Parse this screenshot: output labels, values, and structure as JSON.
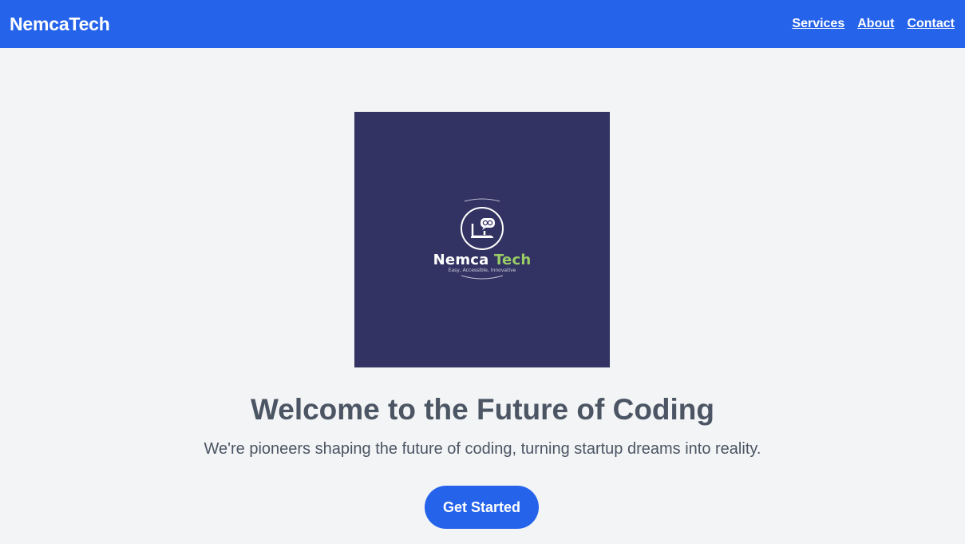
{
  "header": {
    "brand": "NemcaTech",
    "nav": [
      "Services",
      "About",
      "Contact"
    ]
  },
  "hero": {
    "logo": {
      "word_primary": "Nemca",
      "word_secondary": "Tech",
      "tagline": "Easy, Accessible, Innovative",
      "icon": "laptop-chat-icon",
      "background_color": "#333363",
      "accent_color": "#9acd66"
    },
    "headline": "Welcome to the Future of Coding",
    "subtext": "We're pioneers shaping the future of coding, turning startup dreams into reality.",
    "cta_label": "Get Started"
  },
  "colors": {
    "primary": "#2563eb",
    "page_background": "#f3f4f6",
    "text": "#4b5563"
  }
}
